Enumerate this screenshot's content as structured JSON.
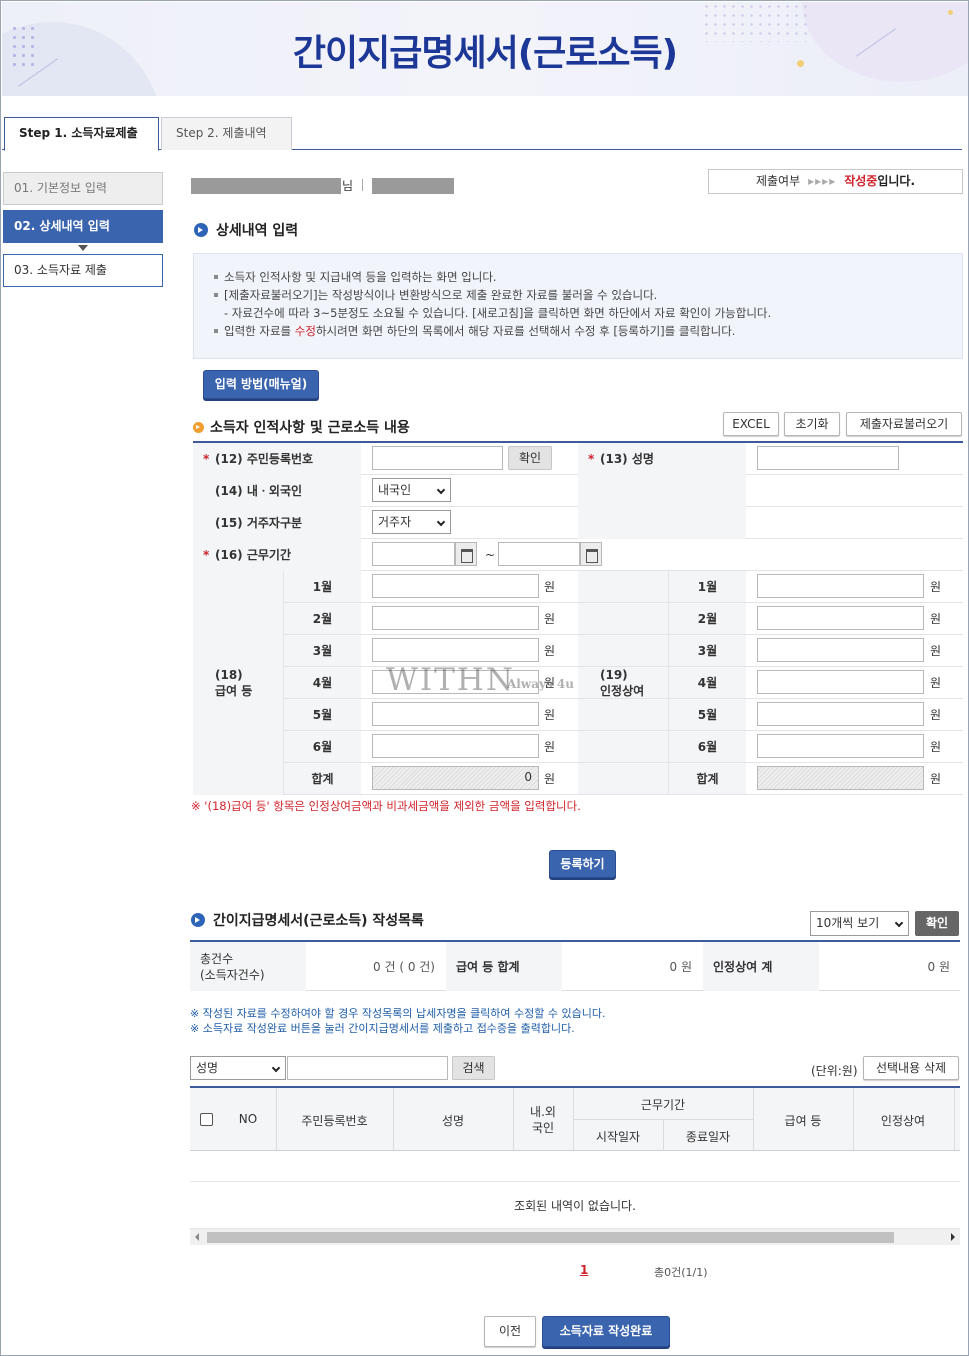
{
  "page_title": "간이지급명세서(근로소득)",
  "tabs": [
    {
      "label": "Step 1. 소득자료제출"
    },
    {
      "label": "Step 2. 제출내역"
    }
  ],
  "left_nav": [
    {
      "label": "01. 기본정보 입력"
    },
    {
      "label": "02. 상세내역 입력"
    },
    {
      "label": "03. 소득자료 제출"
    }
  ],
  "user_info": {
    "suffix": "님"
  },
  "status": {
    "label": "제출여부",
    "arrows": "▸▸▸▸",
    "state": "작성중",
    "tail": "입니다."
  },
  "detail_section": {
    "title": "상세내역 입력"
  },
  "guide": {
    "line1": "소득자 인적사항 및 지급내역 등을 입력하는 화면 입니다.",
    "line2": "[제출자료불러오기]는 작성방식이나 변환방식으로 제출 완료한 자료를 불러올 수 있습니다.",
    "line3": "- 자료건수에 따라 3~5분정도 소요될 수 있습니다. [새로고침]을 클릭하면 화면 하단에서 자료 확인이 가능합니다.",
    "line4_a": "입력한 자료를 ",
    "line4_red": "수정",
    "line4_b": "하시려면 화면 하단의 목록에서 해당 자료를 선택해서 수정 후 [등록하기]를 클릭합니다."
  },
  "manual_button": "입력 방법(매뉴얼)",
  "person_section": {
    "title": "소득자 인적사항 및 근로소득 내용",
    "btn_excel": "EXCEL",
    "btn_reset": "초기화",
    "btn_load": "제출자료불러오기"
  },
  "form": {
    "rrn_label": "(12) 주민등록번호",
    "confirm_btn": "확인",
    "name_label": "(13) 성명",
    "domestic_label": "(14) 내ㆍ외국인",
    "domestic_value": "내국인",
    "resident_label": "(15) 거주자구분",
    "resident_value": "거주자",
    "period_label": "(16) 근무기간",
    "tilde": "~",
    "wage_label_a": "(18)",
    "wage_label_b": "급여 등",
    "bonus_label_a": "(19)",
    "bonus_label_b": "인정상여",
    "months": [
      "1월",
      "2월",
      "3월",
      "4월",
      "5월",
      "6월"
    ],
    "total_label": "합계",
    "wage_total": "0",
    "unit": "원"
  },
  "form_note": "※ '(18)급여 등' 항목은 인정상여금액과 비과세금액을 제외한 금액을 입력합니다.",
  "register_button": "등록하기",
  "list_section": {
    "title": "간이지급명세서(근로소득) 작성목록",
    "page_size": "10개씩 보기",
    "confirm_btn": "확인"
  },
  "summary": {
    "count_label_a": "총건수",
    "count_label_b": "(소득자건수)",
    "count_value": "0 건 ( 0 건)",
    "wage_label": "급여 등 합계",
    "wage_value": "0 원",
    "bonus_label": "인정상여 계",
    "bonus_value": "0 원"
  },
  "list_notes": {
    "line1": "※ 작성된 자료를 수정하여야 할 경우 작성목록의 납세자명을 클릭하여 수정할 수 있습니다.",
    "line2": "※ 소득자료 작성완료 버튼을 눌러 간이지급명세서를 제출하고 접수증을 출력합니다."
  },
  "search": {
    "field_value": "성명",
    "search_btn": "검색",
    "unit_text": "(단위:원)",
    "delete_btn": "선택내용 삭제"
  },
  "table": {
    "col_no": "NO",
    "col_rrn": "주민등록번호",
    "col_name": "성명",
    "col_nat_a": "내.외",
    "col_nat_b": "국인",
    "col_period": "근무기간",
    "col_start": "시작일자",
    "col_end": "종료일자",
    "col_wage": "급여 등",
    "col_bonus": "인정상여",
    "empty": "조회된 내역이 없습니다."
  },
  "pagination": {
    "page": "1",
    "total": "총0건(1/1)"
  },
  "footer": {
    "prev_btn": "이전",
    "complete_btn": "소득자료 작성완료"
  },
  "watermark": {
    "main": "WITHN",
    "sub": "Always 4u"
  },
  "colors": {
    "primary": "#3a64ad",
    "title": "#1d3797",
    "alert": "#d0232b"
  }
}
